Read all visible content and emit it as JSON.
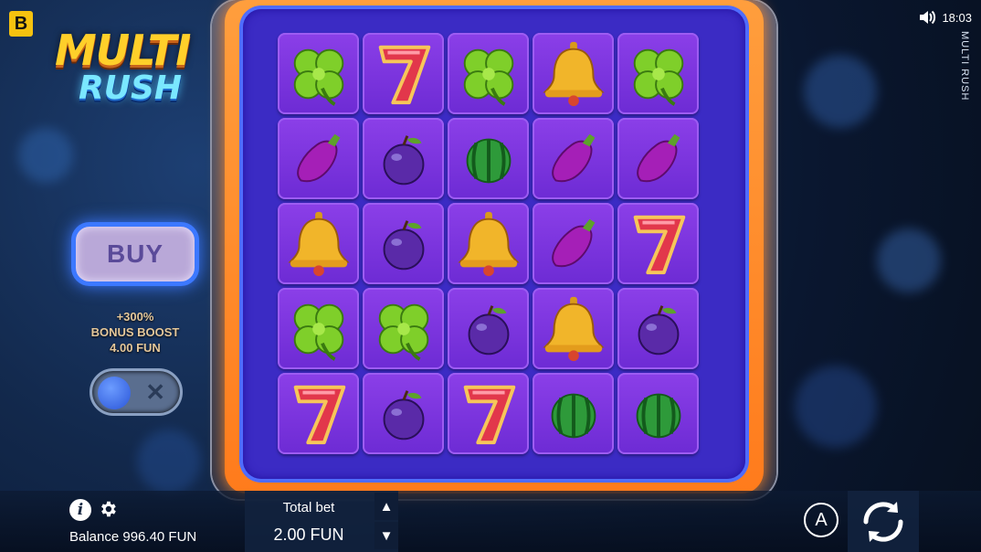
{
  "brand": {
    "badge_letter": "B"
  },
  "game": {
    "logo_line1": "MULTI",
    "logo_line2": "RUSH",
    "vertical_title": "MULTI RUSH"
  },
  "status": {
    "time": "18:03",
    "sound_icon": "speaker-icon"
  },
  "buy": {
    "label": "BUY"
  },
  "boost": {
    "line1": "+300%",
    "line2": "BONUS BOOST",
    "line3": "4.00 FUN",
    "enabled": false
  },
  "reels": {
    "rows": [
      [
        "clover",
        "seven",
        "clover",
        "bell",
        "clover"
      ],
      [
        "eggplant",
        "plum",
        "watermelon",
        "eggplant",
        "eggplant"
      ],
      [
        "bell",
        "plum",
        "bell",
        "eggplant",
        "seven"
      ],
      [
        "clover",
        "clover",
        "plum",
        "bell",
        "plum"
      ],
      [
        "seven",
        "plum",
        "seven",
        "watermelon",
        "watermelon"
      ]
    ]
  },
  "bottom": {
    "balance": "Balance 996.40 FUN",
    "total_bet_label": "Total bet",
    "total_bet_value": "2.00 FUN",
    "info_glyph": "i",
    "autoplay_glyph": "A"
  },
  "colors": {
    "frame_orange": "#ff8a2a",
    "cell_purple": "#7b35de",
    "accent_blue": "#3c78ff"
  }
}
